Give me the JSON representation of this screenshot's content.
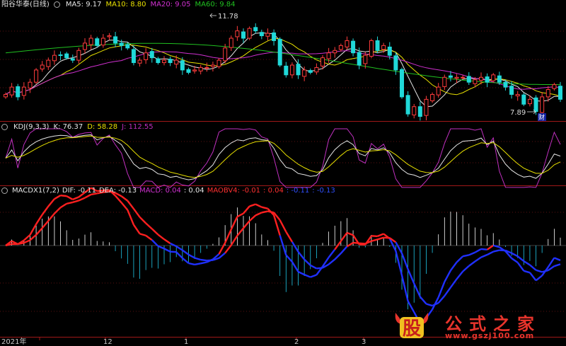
{
  "price_panel": {
    "title": "阳谷华泰(日线)",
    "ma5": "MA5: 9.17",
    "ma10": "MA10: 8.80",
    "ma20": "MA20: 9.05",
    "ma60": "MA60: 9.84",
    "high_label": "11.78",
    "low_label": "7.89",
    "event_marker": "财"
  },
  "kdj_panel": {
    "name": "KDJ(9,3,3)",
    "k": "K: 76.37",
    "d": "D: 58.28",
    "j": "J: 112.55"
  },
  "macd_panel": {
    "name": "MACDX1(7,2)",
    "dif": "DIF: -0.11",
    "dea": "DEA: -0.13",
    "macd": "MACD: 0.04",
    "v4": ": 0.04",
    "maobv4": "MAOBV4: -0.01",
    "v6": ": 0.04",
    "v7": ": -0.11",
    "v8": ": -0.13"
  },
  "x_axis": {
    "labels": [
      "2021年",
      "12",
      "1",
      "2",
      "3"
    ]
  },
  "watermark": {
    "glyph": "股",
    "text": "公式之家",
    "url": "www.gszj100.com"
  },
  "colors": {
    "ma5": "#e6e6e6",
    "ma10": "#e8e000",
    "ma20": "#d030d0",
    "ma60": "#20c020",
    "up": "#ff3c3c",
    "down": "#20d8d8",
    "k": "#e6e6e6",
    "d": "#e8e000",
    "j": "#c030c0",
    "macd_red": "#ff2020",
    "macd_blue": "#2030ff",
    "divider": "#a01818"
  },
  "chart_data": [
    {
      "type": "candlestick",
      "title": "阳谷华泰(日线)",
      "series": [
        {
          "name": "MA5",
          "last": 9.17
        },
        {
          "name": "MA10",
          "last": 8.8
        },
        {
          "name": "MA20",
          "last": 9.05
        },
        {
          "name": "MA60",
          "last": 9.84
        }
      ],
      "annotations": [
        {
          "text": "11.78",
          "kind": "high"
        },
        {
          "text": "7.89",
          "kind": "low"
        }
      ],
      "close": [
        8.6,
        8.9,
        8.5,
        8.9,
        9.1,
        9.6,
        9.8,
        10.0,
        10.2,
        10.2,
        10.1,
        10.0,
        10.4,
        10.7,
        10.9,
        10.6,
        10.9,
        11.0,
        10.7,
        10.6,
        10.5,
        9.9,
        10.0,
        10.3,
        10.1,
        9.9,
        10.0,
        9.9,
        10.0,
        9.6,
        9.5,
        9.6,
        9.7,
        9.7,
        9.8,
        10.0,
        10.5,
        10.9,
        11.2,
        10.9,
        11.3,
        11.2,
        11.0,
        11.1,
        10.8,
        9.8,
        9.4,
        9.8,
        9.4,
        9.6,
        9.5,
        9.7,
        10.1,
        10.3,
        10.4,
        10.6,
        10.8,
        10.3,
        9.8,
        10.2,
        10.8,
        10.4,
        10.6,
        10.2,
        9.6,
        8.5,
        7.8,
        8.1,
        7.7,
        8.4,
        8.6,
        8.9,
        9.3,
        9.3,
        9.3,
        9.3,
        9.1,
        9.2,
        9.3,
        9.1,
        9.4,
        9.1,
        8.9,
        8.6,
        8.6,
        8.2,
        8.4,
        7.9,
        8.5,
        8.8,
        9.0,
        8.4
      ]
    },
    {
      "type": "line",
      "title": "KDJ(9,3,3)",
      "series": [
        {
          "name": "K",
          "last": 76.37
        },
        {
          "name": "D",
          "last": 58.28
        },
        {
          "name": "J",
          "last": 112.55
        }
      ]
    },
    {
      "type": "bar",
      "title": "MACDX1(7,2)",
      "series": [
        {
          "name": "DIF",
          "last": -0.11
        },
        {
          "name": "DEA",
          "last": -0.13
        },
        {
          "name": "MACD",
          "last": 0.04
        },
        {
          "name": "MAOBV4",
          "last": -0.01
        }
      ]
    }
  ]
}
